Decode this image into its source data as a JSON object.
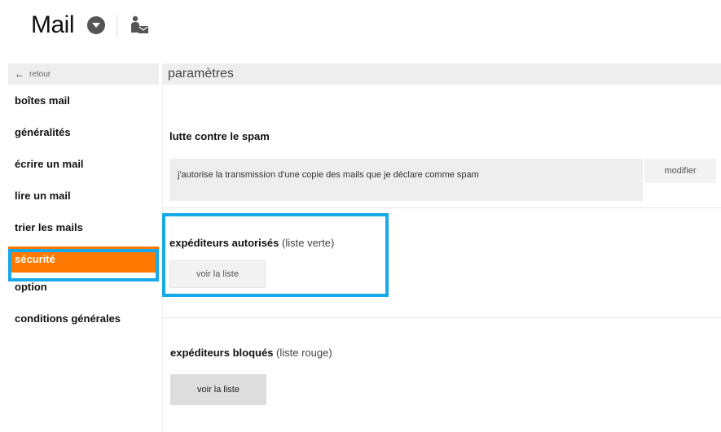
{
  "header": {
    "title": "Mail",
    "dropdown_icon": "chevron-down-circle-icon",
    "contact_icon": "contact-mail-icon"
  },
  "sidebar": {
    "back_label": "retour",
    "items": [
      {
        "label": "boîtes mail"
      },
      {
        "label": "généralités"
      },
      {
        "label": "écrire un mail"
      },
      {
        "label": "lire un mail"
      },
      {
        "label": "trier les mails"
      },
      {
        "label": "sécurité",
        "active": true
      },
      {
        "label": "option"
      },
      {
        "label": "conditions générales"
      }
    ]
  },
  "main": {
    "title": "paramètres",
    "spam": {
      "title": "lutte contre le spam",
      "text": "j'autorise la transmission d'une copie des mails que je déclare comme spam",
      "modify_label": "modifier"
    },
    "whitelist": {
      "title": "expéditeurs autorisés",
      "subtitle": "(liste verte)",
      "button_label": "voir la liste"
    },
    "blacklist": {
      "title": "expéditeurs bloqués",
      "subtitle": "(liste rouge)",
      "button_label": "voir la liste"
    }
  },
  "colors": {
    "accent": "#ff7900",
    "highlight": "#18a9e8",
    "header_bg": "#eeeeee"
  }
}
